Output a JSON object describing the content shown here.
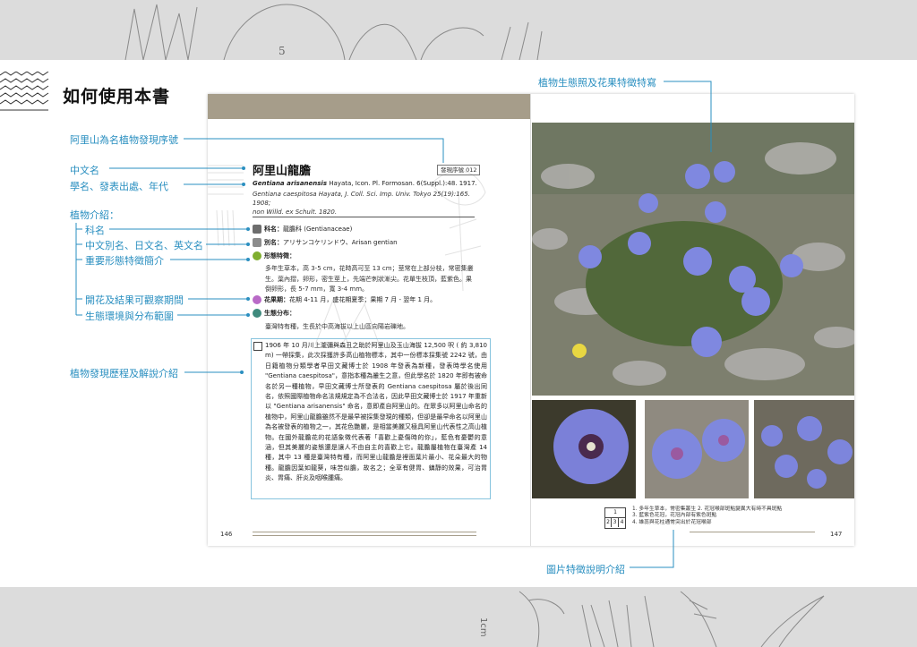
{
  "page": {
    "band_number": "5",
    "band_unit": "1cm",
    "heading": "如何使用本書"
  },
  "annotations": {
    "serial_number": "阿里山為名植物發現序號",
    "chinese_name": "中文名",
    "scientific_name": "學名、發表出處、年代",
    "plant_intro": "植物介紹：",
    "family": "科名",
    "aliases": "中文別名、日文名、英文名",
    "morphology": "重要形態特徵簡介",
    "flowering": "開花及結果可觀察期間",
    "habitat": "生態環境與分布範圍",
    "discovery": "植物發現歷程及解說介紹",
    "photos": "植物生態照及花果特徵特寫",
    "captions": "圖片特徵說明介紹"
  },
  "entry": {
    "title": "阿里山龍膽",
    "serial_badge": "發現序號 012",
    "sci_name_italic": "Gentiana arisanensis",
    "sci_name_rest": "Hayata, Icon. Pl. Formosan. 6(Suppl.):48. 1917.",
    "synonym_line1": "Gentiana caespitosa Hayata, J. Coll. Sci. Imp. Univ. Tokyo 25(19):165. 1908;",
    "synonym_line2": "non Willd. ex Schult. 1820.",
    "family_label": "科名：",
    "family_value": "龍膽科 (Gentianaceae)",
    "alias_label": "別名：",
    "alias_value": "アリサンコケリンドウ、Arisan gentian",
    "morph_label": "形態特徵：",
    "morph_text": "多年生草本，高 3-5 cm，花時高可至 13 cm；莖常在上部分枝，常密集叢生。葉內摺，卵形，密生莖上，先端芒刺狀漸尖。花單生枝頂，藍紫色。果倒卵形，長 5-7 mm，寬 3-4 mm。",
    "flower_label": "花果期：",
    "flower_value": "花期 4-11 月，盛花期夏季；果期 7 月 - 翌年 1 月。",
    "habitat_label": "生態分布：",
    "habitat_text": "臺灣特有種，生長於中高海拔以上山區向陽岩礫地。",
    "discovery_text": "1906 年 10 月川上瀧彌與森丑之助於阿里山及玉山海拔 12,500 呎 ( 約 3,810 m) 一帶採集，此次採獲許多高山植物標本，其中一份標本採集號 2242 號，由日籍植物分類學者早田文藏博士於 1908 年發表為新種，發表時學名使用 \"Gentiana caespitosa\"，意指本種為叢生之意，但此學名於 1820 年即有被命名於另一種植物，早田文藏博士所發表的 Gentiana caespitosa 屬於後出同名，依照國際植物命名法規規定為不合法名，因此早田文藏博士於 1917 年重新以 \"Gentiana arisanensis\" 命名，意即產自阿里山的。在眾多以阿里山命名的植物中，阿里山龍膽雖然不是最早被採集發現的種類，但卻是最早命名以阿里山為名被發表的植物之一，其花色艷麗，是相當美麗又極具阿里山代表性之高山植物。在國外龍膽花的花語象徵代表著「喜歡上憂傷時的你」，藍色有憂鬱的意涵，但其美麗的姿態還是讓人不由自主的喜歡上它。龍膽屬植物在臺灣產 14 種，其中 13 種是臺灣特有種，而阿里山龍膽是裡面葉片最小、花朵最大的物種。龍膽因葉如龍葵，味苦似膽，故名之；全草有健胃、鎮靜的效果，可治胃炎、胃痛、肝炎及咽喉腫痛。",
    "page_left": "146",
    "page_right": "147"
  },
  "photo_grid": {
    "top": "1",
    "b2": "2",
    "b3": "3",
    "b4": "4"
  },
  "captions": {
    "line1": "1. 多年生草本，常密集叢生 2. 花冠喉部斑點變異大有時不具斑點",
    "line2": "3. 藍紫色花冠，花冠內部有紫色斑點",
    "line3": "4. 雄蕊與花柱通常突出於花冠喉部"
  },
  "colors": {
    "accent": "#2a8fc0",
    "header_bar": "#a69d8a",
    "flower": "#6f79d8"
  },
  "icons": [
    "zigzag-pattern",
    "book-icon",
    "pencil-icon",
    "leaf-icon",
    "flower-icon",
    "globe-icon",
    "note-icon"
  ]
}
